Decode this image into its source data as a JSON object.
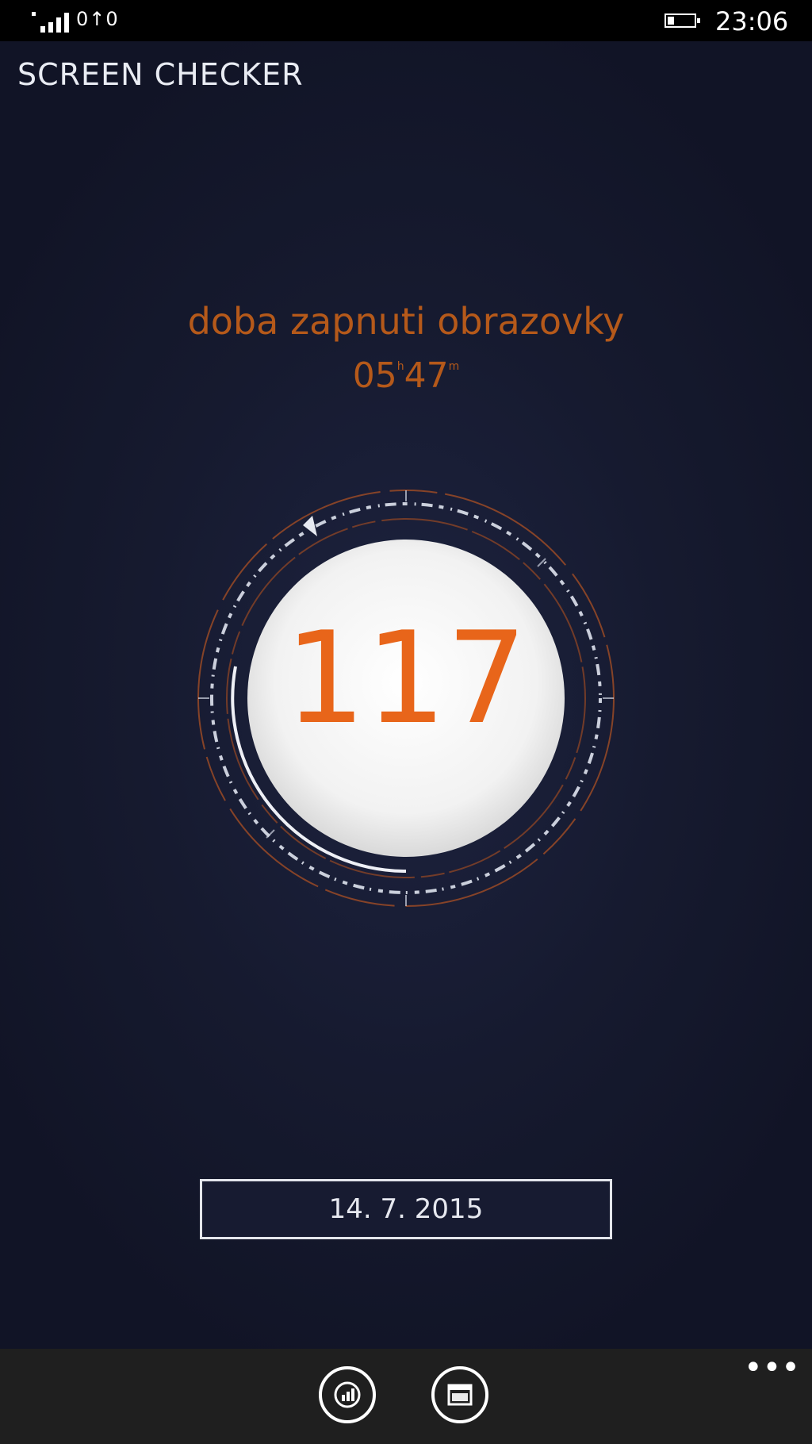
{
  "status_bar": {
    "network_glyph": "0↑0",
    "time": "23:06"
  },
  "app": {
    "title": "SCREEN CHECKER"
  },
  "main": {
    "caption": "doba zapnuti obrazovky",
    "hours": "05",
    "hours_unit": "h",
    "minutes": "47",
    "minutes_unit": "m",
    "unlock_count": "117",
    "date_button": "14. 7. 2015"
  },
  "app_bar": {
    "buttons": [
      {
        "icon": "statistics-icon"
      },
      {
        "icon": "calendar-icon"
      }
    ],
    "more": "•••"
  },
  "colors": {
    "accent": "#e8651a",
    "caption": "#b5591a",
    "background": "#161a2f"
  }
}
